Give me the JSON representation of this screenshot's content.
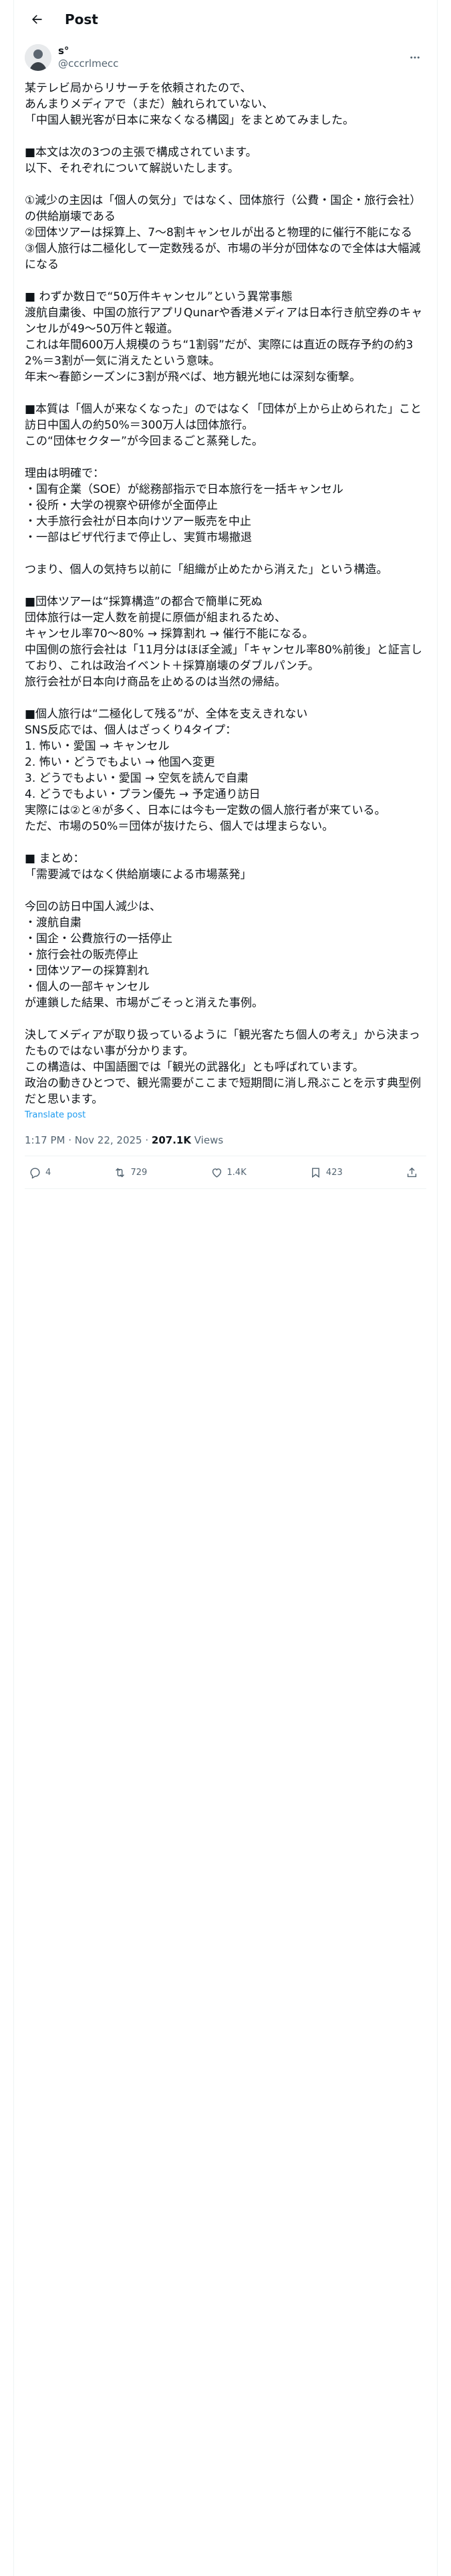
{
  "header": {
    "title": "Post"
  },
  "author": {
    "display_name": "s°",
    "handle": "@cccrlmecc"
  },
  "post": {
    "text": "某テレビ局からリサーチを依頼されたので、\nあんまりメディアで（まだ）触れられていない、\n「中国人観光客が日本に来なくなる構図」をまとめてみました。\n\n■本文は次の3つの主張で構成されています。\n以下、それぞれについて解説いたします。\n\n①減少の主因は「個人の気分」ではなく、団体旅行（公費・国企・旅行会社）の供給崩壊である\n②団体ツアーは採算上、7〜8割キャンセルが出ると物理的に催行不能になる\n③個人旅行は二極化して一定数残るが、市場の半分が団体なので全体は大幅減になる\n\n■ わずか数日で“50万件キャンセル”という異常事態\n渡航自粛後、中国の旅行アプリQunarや香港メディアは日本行き航空券のキャンセルが49〜50万件と報道。\nこれは年間600万人規模のうち“1割弱”だが、実際には直近の既存予約の約32%＝3割が一気に消えたという意味。\n年末〜春節シーズンに3割が飛べば、地方観光地には深刻な衝撃。\n\n■本質は「個人が来なくなった」のではなく「団体が上から止められた」こと\n訪日中国人の約50%＝300万人は団体旅行。\nこの“団体セクター”が今回まるごと蒸発した。\n\n理由は明確で：\n・国有企業（SOE）が総務部指示で日本旅行を一括キャンセル\n・役所・大学の視察や研修が全面停止\n・大手旅行会社が日本向けツアー販売を中止\n・一部はビザ代行まで停止し、実質市場撤退\n\nつまり、個人の気持ち以前に「組織が止めたから消えた」という構造。\n\n■団体ツアーは“採算構造”の都合で簡単に死ぬ\n団体旅行は一定人数を前提に原価が組まれるため、\nキャンセル率70〜80% → 採算割れ → 催行不能になる。\n中国側の旅行会社は「11月分はほぼ全滅」「キャンセル率80%前後」と証言しており、これは政治イベント＋採算崩壊のダブルパンチ。\n旅行会社が日本向け商品を止めるのは当然の帰結。\n\n■個人旅行は“二極化して残る”が、全体を支えきれない\nSNS反応では、個人はざっくり4タイプ：\n1. 怖い・愛国 → キャンセル\n2. 怖い・どうでもよい → 他国へ変更\n3. どうでもよい・愛国 → 空気を読んで自粛\n4. どうでもよい・プラン優先 → 予定通り訪日\n実際には②と④が多く、日本には今も一定数の個人旅行者が来ている。\nただ、市場の50%＝団体が抜けたら、個人では埋まらない。\n\n■ まとめ：\n「需要減ではなく供給崩壊による市場蒸発」\n\n今回の訪日中国人減少は、\n・渡航自粛\n・国企・公費旅行の一括停止\n・旅行会社の販売停止\n・団体ツアーの採算割れ\n・個人の一部キャンセル\nが連鎖した結果、市場がごそっと消えた事例。\n\n決してメディアが取り扱っているように「観光客たち個人の考え」から決まったものではない事が分かります。\nこの構造は、中国語圏では「観光の武器化」とも呼ばれています。\n政治の動きひとつで、観光需要がここまで短期間に消し飛ぶことを示す典型例だと思います。",
    "translate_label": "Translate post",
    "timestamp": "1:17 PM · Nov 22, 2025",
    "separator": " · ",
    "views_count": "207.1K",
    "views_label": " Views"
  },
  "actions": {
    "replies": "4",
    "reposts": "729",
    "likes": "1.4K",
    "bookmarks": "423"
  },
  "colors": {
    "accent": "#1d9bf0",
    "muted": "#536471",
    "border": "#eff3f4"
  }
}
